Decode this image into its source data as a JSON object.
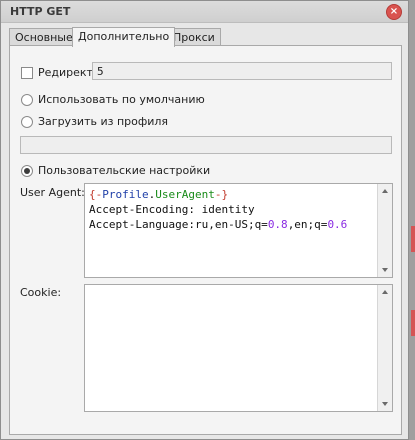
{
  "window": {
    "title": "HTTP GET",
    "close_glyph": "×"
  },
  "tabs": [
    {
      "label": "Основные",
      "active": false
    },
    {
      "label": "Дополнительно",
      "active": true
    },
    {
      "label": "Прокси",
      "active": false
    }
  ],
  "redirect": {
    "label": "Редирект",
    "checked": false,
    "value": "5"
  },
  "options": {
    "use_default": {
      "label": "Использовать по умолчанию",
      "selected": false
    },
    "load_profile": {
      "label": "Загрузить из профиля",
      "selected": false,
      "value": ""
    },
    "custom": {
      "label": "Пользовательские настройки",
      "selected": true
    }
  },
  "user_agent": {
    "label": "User Agent:",
    "lines": [
      [
        {
          "text": "{-",
          "kind": "brace"
        },
        {
          "text": "Profile",
          "kind": "key"
        },
        {
          "text": ".",
          "kind": "plain"
        },
        {
          "text": "UserAgent",
          "kind": "prop"
        },
        {
          "text": "-}",
          "kind": "brace"
        }
      ],
      [
        {
          "text": "Accept-Encoding: identity",
          "kind": "plain"
        }
      ],
      [
        {
          "text": "Accept-Language:ru,en-US;q=",
          "kind": "plain"
        },
        {
          "text": "0.8",
          "kind": "num"
        },
        {
          "text": ",en;q=",
          "kind": "plain"
        },
        {
          "text": "0.6",
          "kind": "num"
        }
      ]
    ]
  },
  "cookie": {
    "label": "Cookie:",
    "value": ""
  },
  "colors": {
    "brace": "#c0392b",
    "key": "#1f3fa8",
    "prop": "#1a8c1a",
    "num": "#8a2be2",
    "close_button": "#d9534f"
  },
  "icons": {
    "close": "close-icon",
    "scroll_up": "arrow-up-icon",
    "scroll_down": "arrow-down-icon"
  }
}
